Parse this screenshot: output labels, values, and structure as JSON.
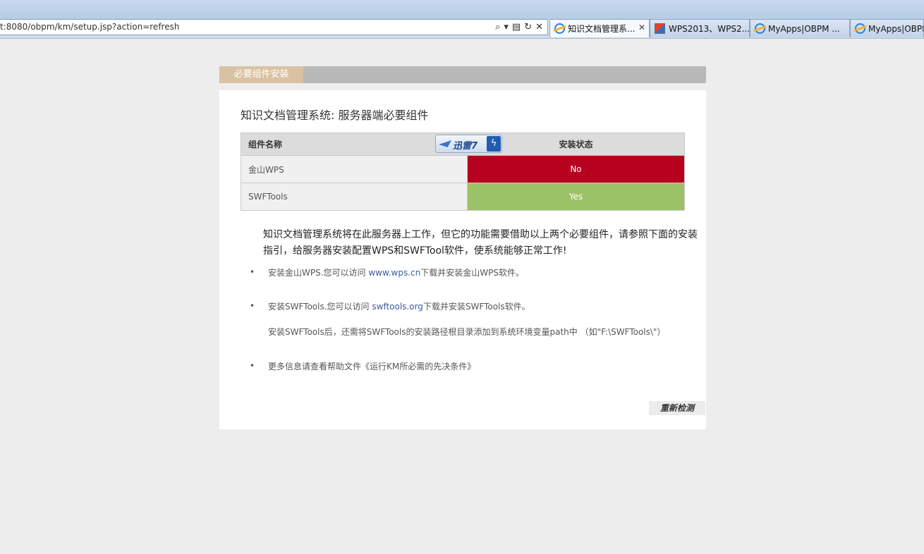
{
  "browser": {
    "address": "t:8080/obpm/km/setup.jsp?action=refresh",
    "icons": [
      "search-icon",
      "dropdown-icon",
      "compat-view-icon",
      "refresh-icon",
      "stop-icon"
    ],
    "tabs": [
      {
        "label": "知识文档管理系...",
        "icon": "ie-icon",
        "active": true,
        "close": "✕"
      },
      {
        "label": "WPS2013、WPS2...",
        "icon": "wps-icon",
        "active": false
      },
      {
        "label": "MyApps|OBPM ...",
        "icon": "ie-icon",
        "active": false
      },
      {
        "label": "MyApps|OBPM",
        "icon": "ie-icon",
        "active": false
      }
    ]
  },
  "panel": {
    "tab_label": "必要组件安装",
    "title": "知识文档管理系统: 服务器端必要组件"
  },
  "table": {
    "headers": {
      "name": "组件名称",
      "status": "安装状态"
    },
    "rows": [
      {
        "name": "金山WPS",
        "status": "No"
      },
      {
        "name": "SWFTools",
        "status": "Yes"
      }
    ],
    "colors": {
      "no": "#b8001f",
      "yes": "#9cc268"
    }
  },
  "overlay_badge": {
    "label": "迅雷7",
    "icon": "lightning-icon"
  },
  "intro": "知识文档管理系统将在此服务器上工作，但它的功能需要借助以上两个必要组件，请参照下面的安装指引，给服务器安装配置WPS和SWFTool软件，使系统能够正常工作!",
  "bullets": {
    "dot": "•",
    "wps": {
      "before": "安装金山WPS.您可以访问 ",
      "link": "www.wps.cn",
      "after": "下载并安装金山WPS软件。"
    },
    "swf": {
      "before": "安装SWFTools.您可以访问 ",
      "link": "swftools.org",
      "after": "下载并安装SWFTools软件。"
    },
    "swf_note": "安装SWFTools后，还需将SWFTools的安装路径根目录添加到系统环境变量path中 （如\"F:\\SWFTools\\\"）",
    "more": "更多信息请查看帮助文件《运行KM所必需的先决条件》"
  },
  "actions": {
    "recheck_label": "重新检测"
  }
}
